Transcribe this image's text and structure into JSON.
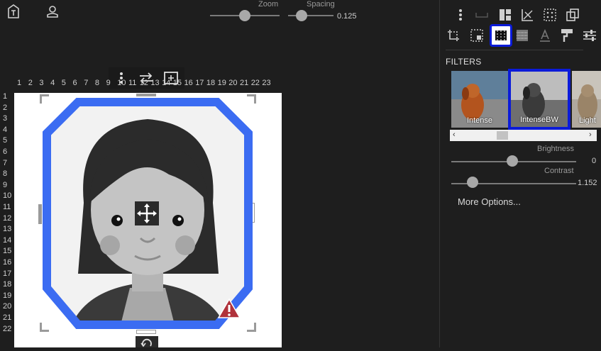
{
  "topbar": {
    "left_icons": [
      "text-icon",
      "user-icon"
    ],
    "zoom": {
      "label": "Zoom",
      "value": 0.5
    },
    "spacing": {
      "label": "Spacing",
      "value": "0.125"
    }
  },
  "canvas_toolbar": {
    "icons": [
      "more-vertical-icon",
      "swap-icon",
      "fit-icon"
    ]
  },
  "rulers": {
    "h_ticks": [
      "1",
      "2",
      "3",
      "4",
      "5",
      "6",
      "7",
      "8",
      "9",
      "10",
      "11",
      "12",
      "13",
      "14",
      "15",
      "16",
      "17",
      "18",
      "19",
      "20",
      "21",
      "22",
      "23"
    ],
    "v_ticks": [
      "1",
      "2",
      "3",
      "4",
      "5",
      "6",
      "7",
      "8",
      "9",
      "10",
      "11",
      "12",
      "13",
      "14",
      "15",
      "16",
      "17",
      "18",
      "19",
      "20",
      "21",
      "22"
    ]
  },
  "right_panel": {
    "toolbar_row1": [
      "more-vertical-icon",
      "dash-icon",
      "layout-icon",
      "chart-icon",
      "grid-dots-icon",
      "copy-icon"
    ],
    "toolbar_row2": [
      "crop-icon",
      "select-icon",
      "filter-icon",
      "pattern-icon",
      "text-color-icon",
      "paint-roller-icon",
      "sliders-icon"
    ],
    "selected_tool": "filter-icon",
    "filters_title": "FILTERS",
    "filters": [
      {
        "label": "Intense",
        "selected": false
      },
      {
        "label": "IntenseBW",
        "selected": true
      },
      {
        "label": "Light",
        "selected": false
      }
    ],
    "brightness": {
      "label": "Brightness",
      "value": "0"
    },
    "contrast": {
      "label": "Contrast",
      "value": "1.152"
    },
    "more_options": "More Options..."
  },
  "colors": {
    "frame_blue": "#3b6cf2",
    "selection_blue": "#0b1bd9",
    "panel_bg": "#1e1e1e"
  }
}
